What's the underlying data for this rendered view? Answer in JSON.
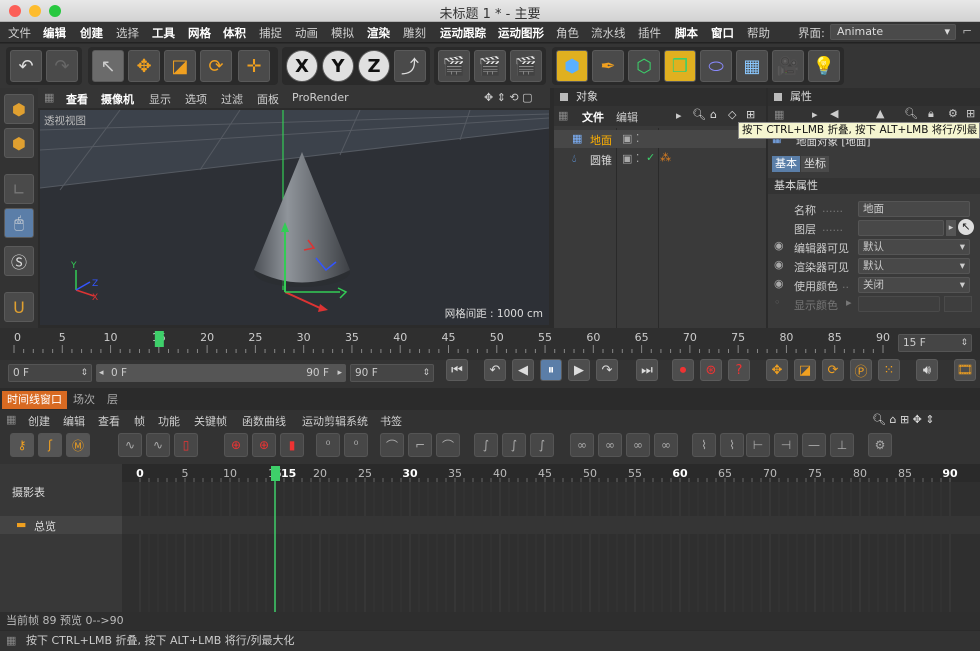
{
  "window": {
    "title": "未标题 1 * - 主要"
  },
  "menubar": {
    "items": [
      "文件",
      "编辑",
      "创建",
      "选择",
      "工具",
      "网格",
      "体积",
      "捕捉",
      "动画",
      "模拟",
      "渲染",
      "雕刻",
      "运动跟踪",
      "运动图形",
      "角色",
      "流水线",
      "插件",
      "脚本",
      "窗口",
      "帮助"
    ],
    "layout_label": "界面:",
    "layout_value": "Animate"
  },
  "toolbar": {
    "undo": "undo-icon",
    "redo": "redo-icon",
    "axes": [
      "X",
      "Y",
      "Z"
    ]
  },
  "viewport": {
    "menu": [
      "查看",
      "摄像机",
      "显示",
      "选项",
      "过滤",
      "面板",
      "ProRender"
    ],
    "label": "透视视图",
    "grid_spacing": "网格间距 : 1000 cm"
  },
  "objects_panel": {
    "title": "对象",
    "menu": [
      "文件",
      "编辑"
    ],
    "items": [
      {
        "name": "地面",
        "selected": true
      },
      {
        "name": "圆锥",
        "selected": false
      }
    ]
  },
  "attributes_panel": {
    "title": "属性",
    "object_label": "地面对象 [地面]",
    "tabs": [
      "基本",
      "坐标"
    ],
    "section": "基本属性",
    "fields": [
      {
        "label": "名称",
        "value": "地面"
      },
      {
        "label": "图层",
        "value": ""
      },
      {
        "label": "编辑器可见",
        "value": "默认"
      },
      {
        "label": "渲染器可见",
        "value": "默认"
      },
      {
        "label": "使用颜色",
        "value": "关闭"
      },
      {
        "label": "显示颜色",
        "value": ""
      }
    ]
  },
  "tooltip": "按下 CTRL+LMB 折叠, 按下 ALT+LMB 将行/列最",
  "timeline_ruler": {
    "ticks": [
      "0",
      "5",
      "10",
      "15",
      "20",
      "25",
      "30",
      "35",
      "40",
      "45",
      "50",
      "55",
      "60",
      "65",
      "70",
      "75",
      "80",
      "85",
      "90"
    ],
    "current_frame_value": 15,
    "frame_field": "15 F"
  },
  "transport": {
    "start": "0 F",
    "range_start": "0 F",
    "range_end": "90 F",
    "end": "90 F"
  },
  "timeline_tabs": [
    "时间线窗口",
    "场次",
    "层"
  ],
  "timeline_menu": [
    "创建",
    "编辑",
    "查看",
    "帧",
    "功能",
    "关键帧",
    "函数曲线",
    "运动剪辑系统",
    "书签"
  ],
  "dopesheet": {
    "label": "摄影表",
    "tracks": [
      "总览"
    ],
    "ticks": [
      "0",
      "5",
      "10",
      "15",
      "20",
      "25",
      "30",
      "35",
      "40",
      "45",
      "50",
      "55",
      "60",
      "65",
      "70",
      "75",
      "80",
      "85",
      "90"
    ],
    "current_frame": "15"
  },
  "status": {
    "line1": "当前帧  89  预览  0-->90",
    "line2": "按下 CTRL+LMB 折叠, 按下 ALT+LMB 将行/列最大化"
  },
  "colors": {
    "accent": "#d86a22",
    "selection": "#ffb000",
    "playhead": "#3ecf6a"
  }
}
